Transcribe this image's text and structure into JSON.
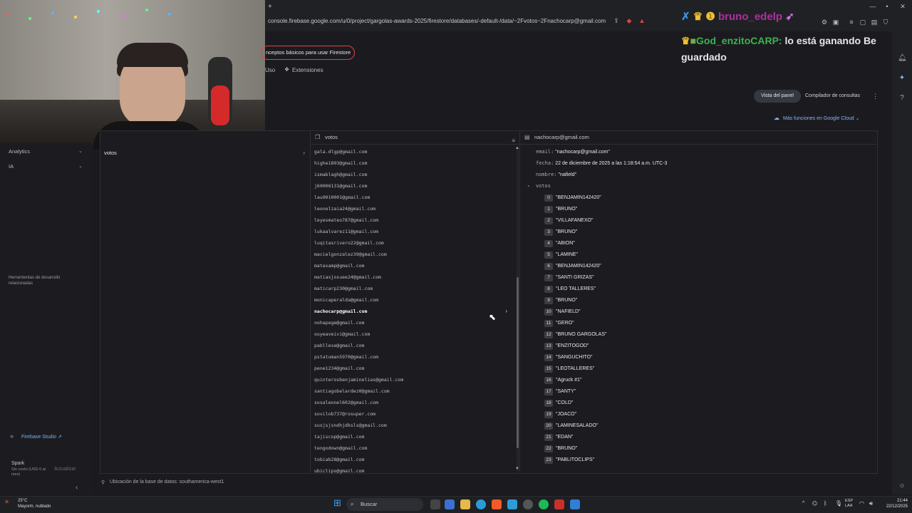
{
  "browser": {
    "url": "console.firebase.google.com/u/0/project/gargolas-awards-2025/firestore/databases/-default-/data/~2Fvotos~2Fnachocarp@gmail.com"
  },
  "banner": {
    "label": "nceptos básicos para usar Firestore"
  },
  "top_tabs": {
    "uso": "Uso",
    "extensiones": "Extensiones"
  },
  "chat": {
    "top_name": "bruno_edelp",
    "user": "God_enzitoCARP:",
    "message": " lo está ganando Be guardado"
  },
  "sidebar": {
    "analytics": "Analytics",
    "ia": "IA",
    "dev_tools": "Herramientas de desarrollo relacionadas",
    "studio": "Firebase Studio",
    "plan": "Spark",
    "plan_sub": "Sin costo (USD 0 al mes)",
    "update": "Actualizar"
  },
  "toolbar": {
    "panel_view": "Vista del panel",
    "query_builder": "Compilador de consultas",
    "more_functions": "Más funciones en Google Cloud"
  },
  "viewer": {
    "col1_item": "votos",
    "col2_header": "votos",
    "col3_header": "nachocarp@gmail.com",
    "documents": [
      "gala.dlgp@gmail.com",
      "highe1893@gmail.com",
      "ismablagh@gmail.com",
      "j69006131@gmail.com",
      "lau9010001@gmail.com",
      "leonelzaia24@gmail.com",
      "leyesmateo787@gmail.com",
      "lukaalvarez11@gmail.com",
      "luqitasrivero22@gmail.com",
      "macielgonzalez39@gmail.com",
      "matexamp@gmail.com",
      "matiasjosuee24@gmail.com",
      "maticarp230@gmail.com",
      "monicaperalda@gmail.com",
      "nachocarp@gmail.com",
      "nohapege@gmail.com",
      "ouyeaveivi@gmail.com",
      "pabllese@gmail.com",
      "pstatuman5970@gmail.com",
      "pene1234@gmail.com",
      "quinterosbenjaminelias@gmail.com",
      "santiagobelardez0@gmail.com",
      "sosaleonel602@gmail.com",
      "sovilob737@rosuper.com",
      "susjsjsndhjdksls@gmail.com",
      "tajiscop@gmail.com",
      "tengodown@gmail.com",
      "tobiab28@gmail.com",
      "ubiclips@gmail.com"
    ],
    "selected_document": "nachocarp@gmail.com",
    "fields": {
      "email_key": "email:",
      "email_val": "\"nachocarp@gmail.com\"",
      "fecha_key": "fecha:",
      "fecha_val": "22 de diciembre de 2025 a las 1:18:54 a.m. UTC-3",
      "nombre_key": "nombre:",
      "nombre_val": "\"nafield\"",
      "votos_key": "votos"
    },
    "votos": [
      "\"BENJAMIN142420\"",
      "\"BRUNO\"",
      "\"VILLAFANEXO\"",
      "\"BRUNO\"",
      "\"ABION\"",
      "\"LAMINE\"",
      "\"BENJAMIN142420\"",
      "\"SANTI GRIZAS\"",
      "\"LEO TALLERES\"",
      "\"BRUNO\"",
      "\"NAFIELD\"",
      "\"GERO\"",
      "\"BRUNO GARGOLAS\"",
      "\"ENZITOGOD\"",
      "\"SANGUCHITO\"",
      "\"LEOTALLERES\"",
      "\"Agruck #1\"",
      "\"SANTY\"",
      "\"COLD\"",
      "\"JOACO\"",
      "\"LAMINESALADO\"",
      "\"EDAN\"",
      "\"BRUNO\"",
      "\"PABLITOCLIPS\""
    ],
    "location": "Ubicación de la base de datos: southamerica-west1"
  },
  "taskbar": {
    "temp": "25°C",
    "weather": "Mayorm. nublado",
    "search": "Buscar",
    "lang1": "ESP",
    "lang2": "LAA",
    "time": "21:44",
    "date": "22/12/2025"
  },
  "colors": {
    "accent": "#8ab4f8",
    "banner_border": "#e0443e",
    "chat_name": "#b02fa0",
    "chat_user": "#3fb24e"
  }
}
